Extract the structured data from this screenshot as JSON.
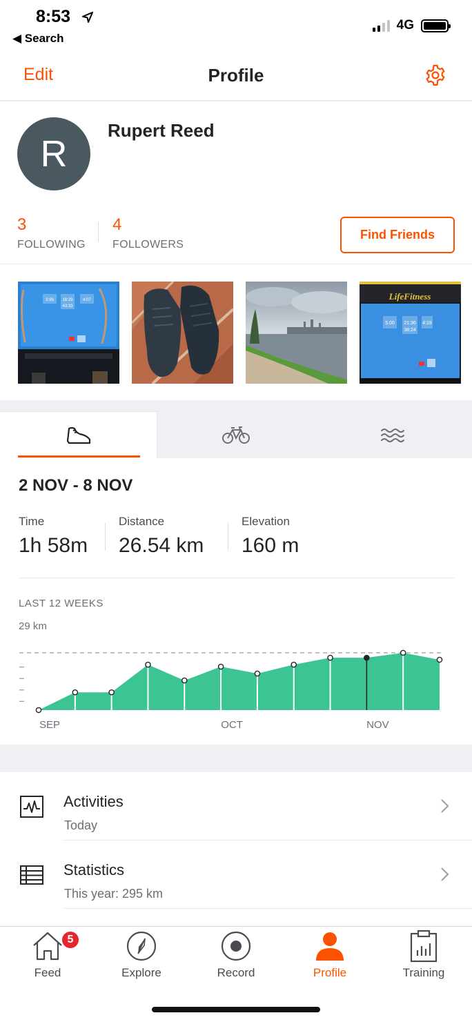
{
  "status_bar": {
    "time": "8:53",
    "back_label": "◀ Search",
    "network": "4G"
  },
  "nav": {
    "edit_label": "Edit",
    "title": "Profile",
    "settings_icon": "gear-icon"
  },
  "profile": {
    "avatar_initial": "R",
    "name": "Rupert Reed",
    "following_count": "3",
    "following_label": "FOLLOWING",
    "followers_count": "4",
    "followers_label": "FOLLOWERS",
    "find_friends_label": "Find Friends"
  },
  "photos": [
    "treadmill-screen",
    "running-shoes",
    "river-view",
    "life-fitness-treadmill"
  ],
  "treadmill_text": {
    "brand": "LifeFitness",
    "values_1": [
      "3.96",
      "16:29",
      "4:07"
    ],
    "values_2": [
      "5.00",
      "21:36",
      "4:19"
    ],
    "time_2": "43:33",
    "time_3": "38:24"
  },
  "sport_tabs": [
    {
      "icon": "run-shoe-icon",
      "active": true
    },
    {
      "icon": "bike-icon",
      "active": false
    },
    {
      "icon": "swim-icon",
      "active": false
    }
  ],
  "week": {
    "range": "2 NOV - 8 NOV",
    "stats": [
      {
        "label": "Time",
        "value": "1h 58m"
      },
      {
        "label": "Distance",
        "value": "26.54 km"
      },
      {
        "label": "Elevation",
        "value": "160 m"
      }
    ]
  },
  "chart_data": {
    "type": "area",
    "title": "LAST 12 WEEKS",
    "ymax_label": "29 km",
    "ylim": [
      0,
      29
    ],
    "x_tick_labels": [
      "SEP",
      "OCT",
      "NOV"
    ],
    "x_tick_index": [
      0,
      5,
      9
    ],
    "values": [
      0,
      9,
      9,
      23,
      15,
      22,
      18.5,
      23,
      26.5,
      26.5,
      29.5,
      25.5
    ],
    "selected_index": 9,
    "color": "#3cc592",
    "dashed_max_line": true
  },
  "menu": [
    {
      "title": "Activities",
      "subtitle": "Today",
      "icon": "activity-graph-icon"
    },
    {
      "title": "Statistics",
      "subtitle": "This year: 295 km",
      "icon": "table-icon"
    }
  ],
  "tabbar": [
    {
      "label": "Feed",
      "icon": "home-icon",
      "badge": "5",
      "active": false
    },
    {
      "label": "Explore",
      "icon": "compass-icon",
      "active": false
    },
    {
      "label": "Record",
      "icon": "record-icon",
      "active": false
    },
    {
      "label": "Profile",
      "icon": "person-icon",
      "active": true
    },
    {
      "label": "Training",
      "icon": "clipboard-chart-icon",
      "active": false
    }
  ],
  "colors": {
    "accent": "#fc5200",
    "chart_fill": "#3cc592",
    "badge": "#e5262e"
  }
}
